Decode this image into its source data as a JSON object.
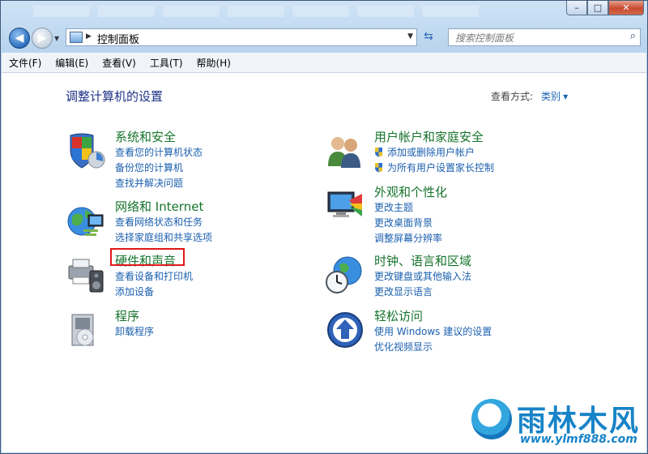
{
  "window": {
    "controls": {
      "minimize": "–",
      "maximize": "□",
      "close": "✕"
    }
  },
  "navbar": {
    "address_crumb": "控制面板",
    "search_placeholder": "搜索控制面板"
  },
  "menu": [
    "文件(F)",
    "编辑(E)",
    "查看(V)",
    "工具(T)",
    "帮助(H)"
  ],
  "main": {
    "heading": "调整计算机的设置",
    "view_by_label": "查看方式:",
    "view_by_value": "类别"
  },
  "categories": [
    {
      "title": "系统和安全",
      "icon": "system-security-icon",
      "links": [
        "查看您的计算机状态",
        "备份您的计算机",
        "查找并解决问题"
      ]
    },
    {
      "title": "网络和 Internet",
      "icon": "network-internet-icon",
      "links": [
        "查看网络状态和任务",
        "选择家庭组和共享选项"
      ]
    },
    {
      "title": "硬件和声音",
      "icon": "hardware-sound-icon",
      "links": [
        "查看设备和打印机",
        "添加设备"
      ]
    },
    {
      "title": "程序",
      "icon": "programs-icon",
      "links": [
        "卸载程序"
      ]
    },
    {
      "title": "用户帐户和家庭安全",
      "icon": "user-accounts-icon",
      "links": [
        "添加或删除用户帐户",
        "为所有用户设置家长控制"
      ]
    },
    {
      "title": "外观和个性化",
      "icon": "appearance-icon",
      "links": [
        "更改主题",
        "更改桌面背景",
        "调整屏幕分辨率"
      ]
    },
    {
      "title": "时钟、语言和区域",
      "icon": "clock-language-icon",
      "links": [
        "更改键盘或其他输入法",
        "更改显示语言"
      ]
    },
    {
      "title": "轻松访问",
      "icon": "ease-of-access-icon",
      "links": [
        "使用 Windows 建议的设置",
        "优化视频显示"
      ]
    }
  ],
  "watermark": {
    "brand": "雨林木风",
    "url": "www.ylmf888.com"
  },
  "colors": {
    "title_green": "#16732c",
    "link_blue": "#1a5fae",
    "heading_blue": "#1e3287",
    "highlight_red": "#e01818"
  }
}
